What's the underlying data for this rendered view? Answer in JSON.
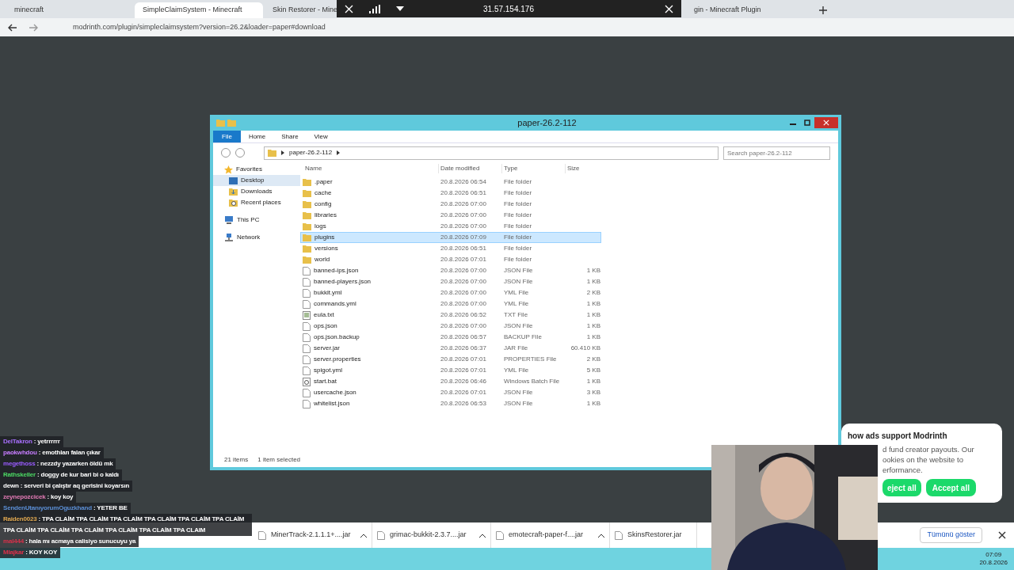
{
  "browser": {
    "tabs": [
      {
        "title": "minecraft",
        "selected": false
      },
      {
        "title": "SimpleClaimSystem - Minecraft",
        "selected": true
      },
      {
        "title": "Skin Restorer - Mine",
        "selected": false
      },
      {
        "title": "gin - Minecraft Plugin",
        "selected": false
      }
    ],
    "url": "modrinth.com/plugin/simpleclaimsystem?version=26.2&loader=paper#download"
  },
  "remote_toolbar": {
    "ip": "31.57.154.176"
  },
  "explorer": {
    "title": "paper-26.2-112",
    "ribbon_tabs": [
      {
        "label": "File",
        "selected": true
      },
      {
        "label": "Home",
        "selected": false
      },
      {
        "label": "Share",
        "selected": false
      },
      {
        "label": "View",
        "selected": false
      }
    ],
    "path": "paper-26.2-112",
    "search": {
      "placeholder": "Search paper-26.2-112"
    },
    "nav": [
      {
        "label": "Favorites",
        "kind": "star",
        "selected": false,
        "children": [
          {
            "label": "Desktop",
            "kind": "desktop",
            "selected": true
          },
          {
            "label": "Downloads",
            "kind": "download",
            "selected": false
          },
          {
            "label": "Recent places",
            "kind": "recent",
            "selected": false
          }
        ]
      },
      {
        "label": "This PC",
        "kind": "pc",
        "selected": false
      },
      {
        "label": "Network",
        "kind": "network",
        "selected": false
      }
    ],
    "columns": [
      "Name",
      "Date modified",
      "Type",
      "Size"
    ],
    "files": [
      {
        "name": ".paper",
        "date": "20.8.2026 06:54",
        "type": "File folder",
        "kind": "folder",
        "selected": false
      },
      {
        "name": "cache",
        "date": "20.8.2026 06:51",
        "type": "File folder",
        "kind": "folder",
        "selected": false
      },
      {
        "name": "config",
        "date": "20.8.2026 07:00",
        "type": "File folder",
        "kind": "folder",
        "selected": false
      },
      {
        "name": "libraries",
        "date": "20.8.2026 07:00",
        "type": "File folder",
        "kind": "folder",
        "selected": false
      },
      {
        "name": "logs",
        "date": "20.8.2026 07:00",
        "type": "File folder",
        "kind": "folder",
        "selected": false
      },
      {
        "name": "plugins",
        "date": "20.8.2026 07:09",
        "type": "File folder",
        "kind": "folder",
        "selected": true
      },
      {
        "name": "versions",
        "date": "20.8.2026 06:51",
        "type": "File folder",
        "kind": "folder",
        "selected": false
      },
      {
        "name": "world",
        "date": "20.8.2026 07:01",
        "type": "File folder",
        "kind": "folder",
        "selected": false
      },
      {
        "name": "banned-ips.json",
        "date": "20.8.2026 07:00",
        "type": "JSON File",
        "size": "1 KB",
        "kind": "file",
        "selected": false
      },
      {
        "name": "banned-players.json",
        "date": "20.8.2026 07:00",
        "type": "JSON File",
        "size": "1 KB",
        "kind": "file",
        "selected": false
      },
      {
        "name": "bukkit.yml",
        "date": "20.8.2026 07:00",
        "type": "YML File",
        "size": "2 KB",
        "kind": "file",
        "selected": false
      },
      {
        "name": "commands.yml",
        "date": "20.8.2026 07:00",
        "type": "YML File",
        "size": "1 KB",
        "kind": "file",
        "selected": false
      },
      {
        "name": "eula.txt",
        "date": "20.8.2026 06:52",
        "type": "TXT File",
        "size": "1 KB",
        "kind": "text",
        "selected": false
      },
      {
        "name": "ops.json",
        "date": "20.8.2026 07:00",
        "type": "JSON File",
        "size": "1 KB",
        "kind": "file",
        "selected": false
      },
      {
        "name": "ops.json.backup",
        "date": "20.8.2026 06:57",
        "type": "BACKUP File",
        "size": "1 KB",
        "kind": "file",
        "selected": false
      },
      {
        "name": "server.jar",
        "date": "20.8.2026 06:37",
        "type": "JAR File",
        "size": "60.410 KB",
        "kind": "file",
        "selected": false
      },
      {
        "name": "server.properties",
        "date": "20.8.2026 07:01",
        "type": "PROPERTIES File",
        "size": "2 KB",
        "kind": "file",
        "selected": false
      },
      {
        "name": "spigot.yml",
        "date": "20.8.2026 07:01",
        "type": "YML File",
        "size": "5 KB",
        "kind": "file",
        "selected": false
      },
      {
        "name": "start.bat",
        "date": "20.8.2026 06:46",
        "type": "Windows Batch File",
        "size": "1 KB",
        "kind": "gear",
        "selected": false
      },
      {
        "name": "usercache.json",
        "date": "20.8.2026 07:01",
        "type": "JSON File",
        "size": "3 KB",
        "kind": "file",
        "selected": false
      },
      {
        "name": "whitelist.json",
        "date": "20.8.2026 06:53",
        "type": "JSON File",
        "size": "1 KB",
        "kind": "file",
        "selected": false
      }
    ],
    "status": {
      "count": "21 items",
      "selection": "1 item selected"
    }
  },
  "chat": [
    {
      "user": "DelTakron",
      "text": ": yetrrrrrr",
      "color": "#a970ff"
    },
    {
      "user": "paokwhdou",
      "text": ": emothları falan çıkar",
      "color": "#c77dff"
    },
    {
      "user": "megethoss",
      "text": ": nezzdy yazarken öldü mk",
      "color": "#9a5cff"
    },
    {
      "user": "Rathskeller",
      "text": ": doggy de kur bari bi o kaldı",
      "color": "#4cd964"
    },
    {
      "user": "dewn",
      "text": ": serveri bi çalıştır aq gerisini koyarsın",
      "color": "#ffffff"
    },
    {
      "user": "zeynepozcicek",
      "text": ": koy koy",
      "color": "#e37bb6"
    },
    {
      "user": "SendenUtanıyorumOguzkhand",
      "text": ": YETER BE",
      "color": "#5b8fd6"
    },
    {
      "user": "Raiden0023",
      "text": ": TPA CLAİM TPA CLAİM TPA CLAİM TPA CLAİM TPA CLAİM TPA CLAİM TPA CLAİM TPA CLAİM TPA CLAİM TPA CLAİM TPA CLAİM TPA CLAIM",
      "color": "#e0a850"
    },
    {
      "user": "mal444",
      "text": ": hala mı acmaya calisiyo sunucuyu ya",
      "color": "#d9304a"
    },
    {
      "user": "Mlajkar",
      "text": ": KOY KOY",
      "color": "#e0304a"
    }
  ],
  "downloads": {
    "items": [
      "MinerTrack-2.1.1.1+....jar",
      "grimac-bukkit-2.3.7....jar",
      "emotecraft-paper-f....jar",
      "SkinsRestorer.jar"
    ],
    "show_all": "Tümünü göster"
  },
  "cookie_banner": {
    "title": "how ads support Modrinth",
    "lines": [
      "d fund creator payouts. Our",
      "ookies on the website to",
      "erformance."
    ],
    "reject": "eject all",
    "accept": "Accept all"
  },
  "clock": {
    "time": "07:09",
    "date": "20.8.2026"
  }
}
